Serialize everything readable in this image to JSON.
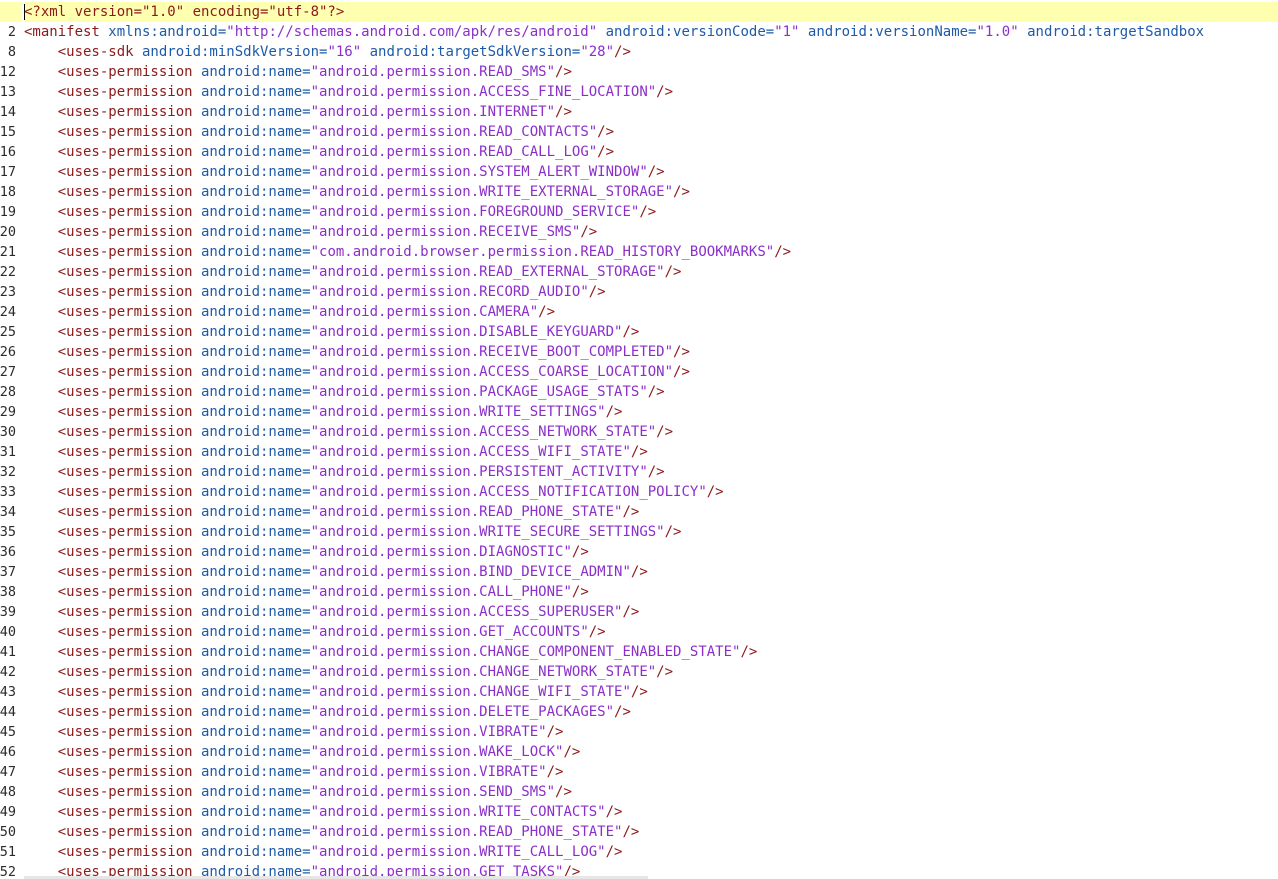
{
  "editor": {
    "header_line": {
      "number": "",
      "text": "<?xml version=\"1.0\" encoding=\"utf-8\"?>"
    },
    "manifest_line": {
      "number": "2",
      "tag": "<manifest",
      "parts": [
        {
          "name": " xmlns:android=",
          "value": "\"http://schemas.android.com/apk/res/android\""
        },
        {
          "name": " android:versionCode=",
          "value": "\"1\""
        },
        {
          "name": " android:versionName=",
          "value": "\"1.0\""
        },
        {
          "name": " android:targetSandbox",
          "value": ""
        }
      ]
    },
    "sdk_line": {
      "number": "8",
      "tag": "<uses-sdk",
      "parts": [
        {
          "name": " android:minSdkVersion=",
          "value": "\"16\""
        },
        {
          "name": " android:targetSdkVersion=",
          "value": "\"28\""
        }
      ],
      "end": "/>"
    },
    "permission_tag": "<uses-permission",
    "permission_attr": " android:name=",
    "permission_end": "/>",
    "permissions": [
      {
        "number": "12",
        "value": "\"android.permission.READ_SMS\""
      },
      {
        "number": "13",
        "value": "\"android.permission.ACCESS_FINE_LOCATION\""
      },
      {
        "number": "14",
        "value": "\"android.permission.INTERNET\""
      },
      {
        "number": "15",
        "value": "\"android.permission.READ_CONTACTS\""
      },
      {
        "number": "16",
        "value": "\"android.permission.READ_CALL_LOG\""
      },
      {
        "number": "17",
        "value": "\"android.permission.SYSTEM_ALERT_WINDOW\""
      },
      {
        "number": "18",
        "value": "\"android.permission.WRITE_EXTERNAL_STORAGE\""
      },
      {
        "number": "19",
        "value": "\"android.permission.FOREGROUND_SERVICE\""
      },
      {
        "number": "20",
        "value": "\"android.permission.RECEIVE_SMS\""
      },
      {
        "number": "21",
        "value": "\"com.android.browser.permission.READ_HISTORY_BOOKMARKS\""
      },
      {
        "number": "22",
        "value": "\"android.permission.READ_EXTERNAL_STORAGE\""
      },
      {
        "number": "23",
        "value": "\"android.permission.RECORD_AUDIO\""
      },
      {
        "number": "24",
        "value": "\"android.permission.CAMERA\""
      },
      {
        "number": "25",
        "value": "\"android.permission.DISABLE_KEYGUARD\""
      },
      {
        "number": "26",
        "value": "\"android.permission.RECEIVE_BOOT_COMPLETED\""
      },
      {
        "number": "27",
        "value": "\"android.permission.ACCESS_COARSE_LOCATION\""
      },
      {
        "number": "28",
        "value": "\"android.permission.PACKAGE_USAGE_STATS\""
      },
      {
        "number": "29",
        "value": "\"android.permission.WRITE_SETTINGS\""
      },
      {
        "number": "30",
        "value": "\"android.permission.ACCESS_NETWORK_STATE\""
      },
      {
        "number": "31",
        "value": "\"android.permission.ACCESS_WIFI_STATE\""
      },
      {
        "number": "32",
        "value": "\"android.permission.PERSISTENT_ACTIVITY\""
      },
      {
        "number": "33",
        "value": "\"android.permission.ACCESS_NOTIFICATION_POLICY\""
      },
      {
        "number": "34",
        "value": "\"android.permission.READ_PHONE_STATE\""
      },
      {
        "number": "35",
        "value": "\"android.permission.WRITE_SECURE_SETTINGS\""
      },
      {
        "number": "36",
        "value": "\"android.permission.DIAGNOSTIC\""
      },
      {
        "number": "37",
        "value": "\"android.permission.BIND_DEVICE_ADMIN\""
      },
      {
        "number": "38",
        "value": "\"android.permission.CALL_PHONE\""
      },
      {
        "number": "39",
        "value": "\"android.permission.ACCESS_SUPERUSER\""
      },
      {
        "number": "40",
        "value": "\"android.permission.GET_ACCOUNTS\""
      },
      {
        "number": "41",
        "value": "\"android.permission.CHANGE_COMPONENT_ENABLED_STATE\""
      },
      {
        "number": "42",
        "value": "\"android.permission.CHANGE_NETWORK_STATE\""
      },
      {
        "number": "43",
        "value": "\"android.permission.CHANGE_WIFI_STATE\""
      },
      {
        "number": "44",
        "value": "\"android.permission.DELETE_PACKAGES\""
      },
      {
        "number": "45",
        "value": "\"android.permission.VIBRATE\""
      },
      {
        "number": "46",
        "value": "\"android.permission.WAKE_LOCK\""
      },
      {
        "number": "47",
        "value": "\"android.permission.VIBRATE\""
      },
      {
        "number": "48",
        "value": "\"android.permission.SEND_SMS\""
      },
      {
        "number": "49",
        "value": "\"android.permission.WRITE_CONTACTS\""
      },
      {
        "number": "50",
        "value": "\"android.permission.READ_PHONE_STATE\""
      },
      {
        "number": "51",
        "value": "\"android.permission.WRITE_CALL_LOG\""
      },
      {
        "number": "52",
        "value": "\"android.permission.GET_TASKS\""
      }
    ],
    "colors": {
      "current_line": "#ffffb0",
      "tag": "#8b1a1a",
      "attr_name": "#1e5aa8",
      "attr_value": "#8b2fc9"
    }
  }
}
